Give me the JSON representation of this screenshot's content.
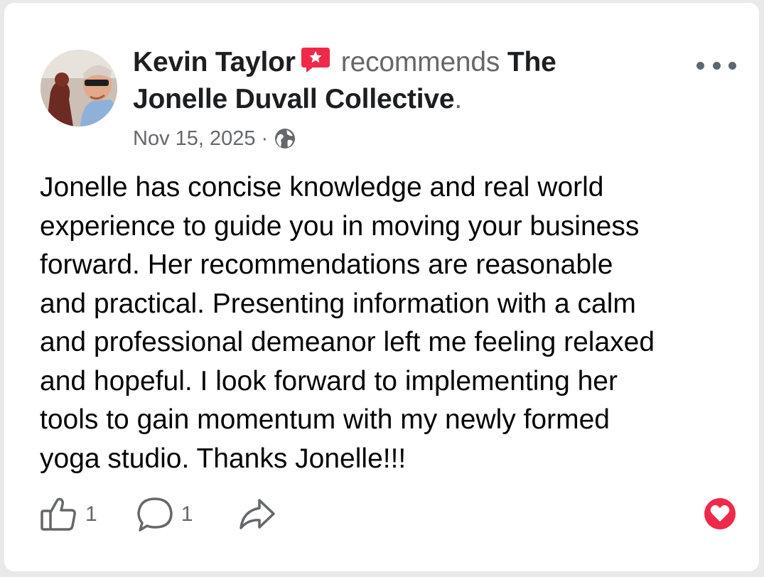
{
  "post": {
    "author": "Kevin Taylor",
    "verb": "recommends",
    "page_name": "The Jonelle Duvall Collective",
    "period": ".",
    "date": "Nov 15, 2025",
    "separator": "·",
    "audience_icon": "globe-icon",
    "badge_icon": "recommendation-badge-icon",
    "more_icon": "more-options-icon",
    "body": "Jonelle has concise knowledge and real world\nexperience to guide you in moving your business\nforward. Her recommendations are reasonable\nand practical. Presenting information with a calm\nand professional demeanor left me feeling relaxed\nand hopeful. I look forward to implementing her\ntools to gain momentum with my newly formed\nyoga studio. Thanks Jonelle!!!"
  },
  "actions": {
    "like_count": "1",
    "comment_count": "1",
    "like_icon": "thumbs-up-icon",
    "comment_icon": "comment-icon",
    "share_icon": "share-icon",
    "reaction_icon": "heart-icon"
  },
  "colors": {
    "badge": "#f02849",
    "heart": "#f02849",
    "text_primary": "#050505",
    "text_secondary": "#65676b"
  }
}
